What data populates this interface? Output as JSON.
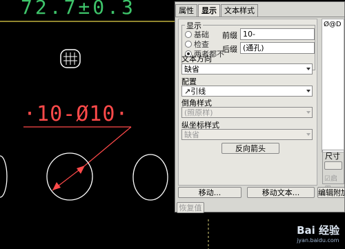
{
  "cad": {
    "top_dimension": "72.7±0.3",
    "red_dimension": "·10-Ø10·"
  },
  "dialog": {
    "tabs": [
      "属性",
      "显示",
      "文本样式"
    ],
    "active_tab": "显示",
    "display_group_title": "显示",
    "radio_options": [
      "基础",
      "检查",
      "两者都不"
    ],
    "selected_radio": "两者都不",
    "prefix_label": "前缀",
    "prefix_value": "10-",
    "suffix_label": "后缀",
    "suffix_value": "(通孔)",
    "text_direction_label": "文本方向",
    "text_direction_value": "缺省",
    "placement_label": "配置",
    "placement_value": "↗引线",
    "chamfer_label": "倒角样式",
    "chamfer_value": "(照原样)",
    "ordinate_label": "纵坐标样式",
    "ordinate_value": "缺省",
    "flip_arrow_button": "反向箭头",
    "preview_text": "Ø@D",
    "dimension_label": "尺寸",
    "enable_label": "启用",
    "move_button": "移动...",
    "move_text_button": "移动文本...",
    "edit_attach_button": "编辑附加",
    "restore_button": "恢复值"
  },
  "watermark": {
    "main": "Bai 经验",
    "sub": "jyan.baidu.com"
  },
  "colors": {
    "cad_green": "#3ec46a",
    "cad_red": "#ff4a4a",
    "dialog_bg": "#d7d7d2"
  }
}
